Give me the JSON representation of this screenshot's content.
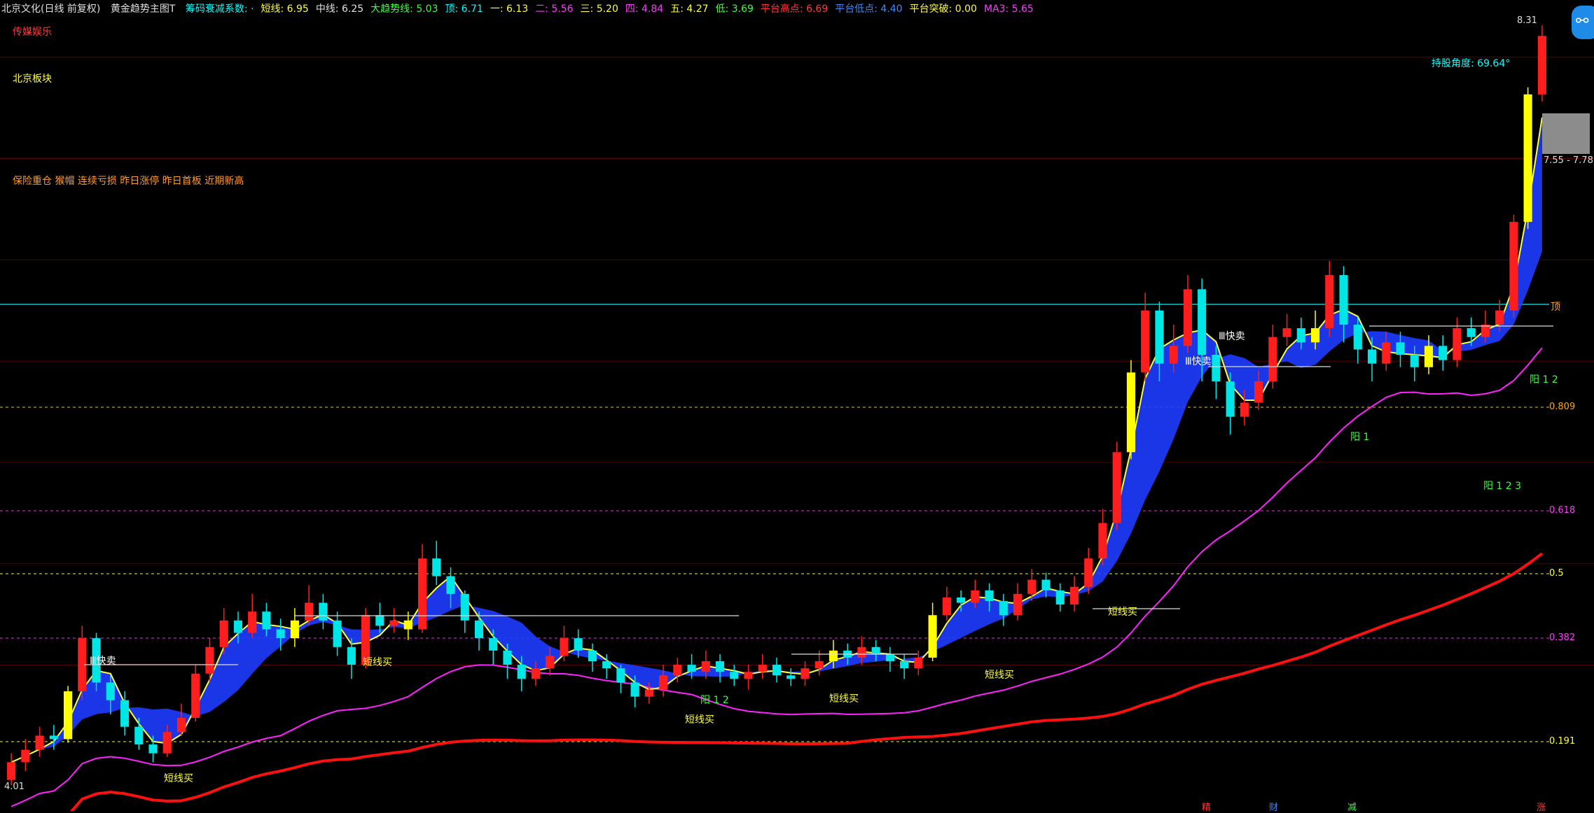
{
  "header": {
    "symbol": "北京文化(日线 前复权)",
    "indicator_name": "黄金趋势主图T",
    "indicators": [
      {
        "label": "筹码衰减系数: ·",
        "color": "#00ffff"
      },
      {
        "label": "短线: 6.95",
        "color": "#ffff3a"
      },
      {
        "label": "中线: 6.25",
        "color": "#e0e0e0"
      },
      {
        "label": "大趋势线: 5.03",
        "color": "#3aff3a"
      },
      {
        "label": "顶: 6.71",
        "color": "#00ffff"
      },
      {
        "label": "一: 6.13",
        "color": "#ffff3a"
      },
      {
        "label": "二: 5.56",
        "color": "#ff3aff"
      },
      {
        "label": "三: 5.20",
        "color": "#ffff3a"
      },
      {
        "label": "四: 4.84",
        "color": "#ff3aff"
      },
      {
        "label": "五: 4.27",
        "color": "#ffff3a"
      },
      {
        "label": "低: 3.69",
        "color": "#3aff3a"
      },
      {
        "label": "平台高点: 6.69",
        "color": "#ff3a3a"
      },
      {
        "label": "平台低点: 4.40",
        "color": "#3a8cff"
      },
      {
        "label": "平台突破: 0.00",
        "color": "#ffff3a"
      },
      {
        "label": "MA3: 5.65",
        "color": "#ff3aff"
      }
    ]
  },
  "side_labels": {
    "concept1": "传媒娱乐",
    "concept2": "北京板块",
    "concept3": "保险重仓 猴帽 连续亏损 昨日涨停 昨日首板 近期新高"
  },
  "angle_label": "持股角度: 69.64°",
  "price_high": "8.31",
  "price_low": "4.01",
  "range_label": "7.55 - 7.78",
  "fib_levels": [
    {
      "label": "0.809",
      "color": "#ffaa00"
    },
    {
      "label": "0.618",
      "color": "#ff3aff"
    },
    {
      "label": "0.5",
      "color": "#ffff3a"
    },
    {
      "label": "0.382",
      "color": "#ff3aff"
    },
    {
      "label": "0.191",
      "color": "#ffff3a"
    }
  ],
  "signals": [
    {
      "text": "Ⅲ快卖",
      "color": "#ffffff"
    },
    {
      "text": "Ⅲ快卖",
      "color": "#ffffff"
    },
    {
      "text": "Ⅲ快卖",
      "color": "#ffffff"
    },
    {
      "text": "短线买",
      "color": "#ffff3a"
    },
    {
      "text": "短线买",
      "color": "#ffff3a"
    },
    {
      "text": "短线买",
      "color": "#ffff3a"
    },
    {
      "text": "短线买",
      "color": "#ffff3a"
    },
    {
      "text": "短线买",
      "color": "#ffff3a"
    },
    {
      "text": "短线买",
      "color": "#ffff3a"
    },
    {
      "text": "顶",
      "color": "#ffaa00"
    },
    {
      "text": "阳 1 2",
      "color": "#3aff3a"
    },
    {
      "text": "阳 1 2 3",
      "color": "#3aff3a"
    },
    {
      "text": "阳 1 2",
      "color": "#3aff3a"
    },
    {
      "text": "阳 1",
      "color": "#3aff3a"
    }
  ],
  "bottom_tags": [
    {
      "text": "精",
      "color": "#ff3a3a"
    },
    {
      "text": "财",
      "color": "#3a8cff"
    },
    {
      "text": "减",
      "color": "#3aff3a"
    },
    {
      "text": "涨",
      "color": "#ff3a3a"
    }
  ],
  "colors": {
    "up_candle": "#ff1e1e",
    "down_candle": "#00e5e5",
    "limit_up_candle": "#ffff00",
    "band_fill": "#1e3cff",
    "short_line": "#ffff3a",
    "ma_magenta": "#ff22ff",
    "ma_red": "#ff1010",
    "hline_cyan": "#00cccc"
  },
  "chart_data": {
    "type": "candlestick",
    "title": "北京文化(日线 前复权)",
    "ylim": [
      4.01,
      8.31
    ],
    "candles": [
      {
        "o": 4.05,
        "c": 4.15,
        "h": 4.2,
        "l": 4.02
      },
      {
        "o": 4.15,
        "c": 4.22,
        "h": 4.28,
        "l": 4.1
      },
      {
        "o": 4.22,
        "c": 4.3,
        "h": 4.35,
        "l": 4.18
      },
      {
        "o": 4.3,
        "c": 4.28,
        "h": 4.36,
        "l": 4.22
      },
      {
        "o": 4.28,
        "c": 4.55,
        "h": 4.58,
        "l": 4.26
      },
      {
        "o": 4.55,
        "c": 4.85,
        "h": 4.92,
        "l": 4.5
      },
      {
        "o": 4.85,
        "c": 4.6,
        "h": 4.88,
        "l": 4.55
      },
      {
        "o": 4.6,
        "c": 4.5,
        "h": 4.64,
        "l": 4.42
      },
      {
        "o": 4.5,
        "c": 4.35,
        "h": 4.55,
        "l": 4.3
      },
      {
        "o": 4.35,
        "c": 4.25,
        "h": 4.4,
        "l": 4.22
      },
      {
        "o": 4.25,
        "c": 4.2,
        "h": 4.3,
        "l": 4.15
      },
      {
        "o": 4.2,
        "c": 4.32,
        "h": 4.36,
        "l": 4.18
      },
      {
        "o": 4.32,
        "c": 4.4,
        "h": 4.48,
        "l": 4.3
      },
      {
        "o": 4.4,
        "c": 4.65,
        "h": 4.7,
        "l": 4.38
      },
      {
        "o": 4.65,
        "c": 4.8,
        "h": 4.85,
        "l": 4.6
      },
      {
        "o": 4.8,
        "c": 4.95,
        "h": 5.02,
        "l": 4.76
      },
      {
        "o": 4.95,
        "c": 4.88,
        "h": 5.0,
        "l": 4.82
      },
      {
        "o": 4.88,
        "c": 5.0,
        "h": 5.1,
        "l": 4.85
      },
      {
        "o": 5.0,
        "c": 4.9,
        "h": 5.05,
        "l": 4.86
      },
      {
        "o": 4.9,
        "c": 4.85,
        "h": 4.96,
        "l": 4.78
      },
      {
        "o": 4.85,
        "c": 4.95,
        "h": 5.02,
        "l": 4.8
      },
      {
        "o": 4.95,
        "c": 5.05,
        "h": 5.15,
        "l": 4.92
      },
      {
        "o": 5.05,
        "c": 4.95,
        "h": 5.1,
        "l": 4.9
      },
      {
        "o": 4.95,
        "c": 4.8,
        "h": 5.0,
        "l": 4.75
      },
      {
        "o": 4.8,
        "c": 4.7,
        "h": 4.85,
        "l": 4.62
      },
      {
        "o": 4.7,
        "c": 4.98,
        "h": 5.02,
        "l": 4.68
      },
      {
        "o": 4.98,
        "c": 4.92,
        "h": 5.05,
        "l": 4.88
      },
      {
        "o": 4.92,
        "c": 4.95,
        "h": 5.02,
        "l": 4.88
      },
      {
        "o": 4.95,
        "c": 4.9,
        "h": 5.0,
        "l": 4.84
      },
      {
        "o": 4.9,
        "c": 5.3,
        "h": 5.38,
        "l": 4.88
      },
      {
        "o": 5.3,
        "c": 5.2,
        "h": 5.4,
        "l": 5.15
      },
      {
        "o": 5.2,
        "c": 5.1,
        "h": 5.25,
        "l": 5.02
      },
      {
        "o": 5.1,
        "c": 4.95,
        "h": 5.12,
        "l": 4.88
      },
      {
        "o": 4.95,
        "c": 4.85,
        "h": 5.0,
        "l": 4.78
      },
      {
        "o": 4.85,
        "c": 4.78,
        "h": 4.9,
        "l": 4.7
      },
      {
        "o": 4.78,
        "c": 4.7,
        "h": 4.82,
        "l": 4.62
      },
      {
        "o": 4.7,
        "c": 4.62,
        "h": 4.75,
        "l": 4.55
      },
      {
        "o": 4.62,
        "c": 4.68,
        "h": 4.72,
        "l": 4.58
      },
      {
        "o": 4.68,
        "c": 4.75,
        "h": 4.8,
        "l": 4.64
      },
      {
        "o": 4.75,
        "c": 4.85,
        "h": 4.92,
        "l": 4.72
      },
      {
        "o": 4.85,
        "c": 4.78,
        "h": 4.9,
        "l": 4.74
      },
      {
        "o": 4.78,
        "c": 4.72,
        "h": 4.82,
        "l": 4.66
      },
      {
        "o": 4.72,
        "c": 4.68,
        "h": 4.76,
        "l": 4.62
      },
      {
        "o": 4.68,
        "c": 4.6,
        "h": 4.7,
        "l": 4.54
      },
      {
        "o": 4.6,
        "c": 4.52,
        "h": 4.64,
        "l": 4.46
      },
      {
        "o": 4.52,
        "c": 4.56,
        "h": 4.6,
        "l": 4.48
      },
      {
        "o": 4.56,
        "c": 4.64,
        "h": 4.7,
        "l": 4.52
      },
      {
        "o": 4.64,
        "c": 4.7,
        "h": 4.74,
        "l": 4.6
      },
      {
        "o": 4.7,
        "c": 4.66,
        "h": 4.76,
        "l": 4.62
      },
      {
        "o": 4.66,
        "c": 4.72,
        "h": 4.78,
        "l": 4.62
      },
      {
        "o": 4.72,
        "c": 4.66,
        "h": 4.76,
        "l": 4.6
      },
      {
        "o": 4.66,
        "c": 4.62,
        "h": 4.7,
        "l": 4.58
      },
      {
        "o": 4.62,
        "c": 4.66,
        "h": 4.7,
        "l": 4.56
      },
      {
        "o": 4.66,
        "c": 4.7,
        "h": 4.76,
        "l": 4.62
      },
      {
        "o": 4.7,
        "c": 4.64,
        "h": 4.74,
        "l": 4.6
      },
      {
        "o": 4.64,
        "c": 4.62,
        "h": 4.68,
        "l": 4.58
      },
      {
        "o": 4.62,
        "c": 4.68,
        "h": 4.72,
        "l": 4.58
      },
      {
        "o": 4.68,
        "c": 4.72,
        "h": 4.78,
        "l": 4.64
      },
      {
        "o": 4.72,
        "c": 4.78,
        "h": 4.84,
        "l": 4.68
      },
      {
        "o": 4.78,
        "c": 4.74,
        "h": 4.82,
        "l": 4.7
      },
      {
        "o": 4.74,
        "c": 4.8,
        "h": 4.86,
        "l": 4.7
      },
      {
        "o": 4.8,
        "c": 4.76,
        "h": 4.84,
        "l": 4.72
      },
      {
        "o": 4.76,
        "c": 4.72,
        "h": 4.8,
        "l": 4.66
      },
      {
        "o": 4.72,
        "c": 4.68,
        "h": 4.76,
        "l": 4.62
      },
      {
        "o": 4.68,
        "c": 4.74,
        "h": 4.78,
        "l": 4.64
      },
      {
        "o": 4.74,
        "c": 4.98,
        "h": 5.05,
        "l": 4.72
      },
      {
        "o": 4.98,
        "c": 5.08,
        "h": 5.14,
        "l": 4.95
      },
      {
        "o": 5.08,
        "c": 5.05,
        "h": 5.12,
        "l": 5.0
      },
      {
        "o": 5.05,
        "c": 5.12,
        "h": 5.18,
        "l": 5.02
      },
      {
        "o": 5.12,
        "c": 5.06,
        "h": 5.16,
        "l": 5.0
      },
      {
        "o": 5.06,
        "c": 4.98,
        "h": 5.1,
        "l": 4.92
      },
      {
        "o": 4.98,
        "c": 5.1,
        "h": 5.16,
        "l": 4.95
      },
      {
        "o": 5.1,
        "c": 5.18,
        "h": 5.24,
        "l": 5.06
      },
      {
        "o": 5.18,
        "c": 5.12,
        "h": 5.22,
        "l": 5.08
      },
      {
        "o": 5.12,
        "c": 5.04,
        "h": 5.16,
        "l": 5.0
      },
      {
        "o": 5.04,
        "c": 5.14,
        "h": 5.2,
        "l": 5.0
      },
      {
        "o": 5.14,
        "c": 5.3,
        "h": 5.36,
        "l": 5.1
      },
      {
        "o": 5.3,
        "c": 5.5,
        "h": 5.58,
        "l": 5.26
      },
      {
        "o": 5.5,
        "c": 5.9,
        "h": 5.96,
        "l": 5.46
      },
      {
        "o": 5.9,
        "c": 6.35,
        "h": 6.42,
        "l": 5.86
      },
      {
        "o": 6.35,
        "c": 6.7,
        "h": 6.8,
        "l": 6.3
      },
      {
        "o": 6.7,
        "c": 6.4,
        "h": 6.75,
        "l": 6.3
      },
      {
        "o": 6.4,
        "c": 6.5,
        "h": 6.62,
        "l": 6.35
      },
      {
        "o": 6.5,
        "c": 6.82,
        "h": 6.9,
        "l": 6.46
      },
      {
        "o": 6.82,
        "c": 6.45,
        "h": 6.88,
        "l": 6.3
      },
      {
        "o": 6.45,
        "c": 6.3,
        "h": 6.5,
        "l": 6.2
      },
      {
        "o": 6.3,
        "c": 6.1,
        "h": 6.35,
        "l": 6.0
      },
      {
        "o": 6.1,
        "c": 6.18,
        "h": 6.25,
        "l": 6.05
      },
      {
        "o": 6.18,
        "c": 6.3,
        "h": 6.36,
        "l": 6.14
      },
      {
        "o": 6.3,
        "c": 6.55,
        "h": 6.62,
        "l": 6.26
      },
      {
        "o": 6.55,
        "c": 6.6,
        "h": 6.68,
        "l": 6.5
      },
      {
        "o": 6.6,
        "c": 6.52,
        "h": 6.66,
        "l": 6.48
      },
      {
        "o": 6.52,
        "c": 6.6,
        "h": 6.7,
        "l": 6.48
      },
      {
        "o": 6.6,
        "c": 6.9,
        "h": 6.98,
        "l": 6.55
      },
      {
        "o": 6.9,
        "c": 6.62,
        "h": 6.95,
        "l": 6.52
      },
      {
        "o": 6.62,
        "c": 6.48,
        "h": 6.66,
        "l": 6.4
      },
      {
        "o": 6.48,
        "c": 6.4,
        "h": 6.55,
        "l": 6.3
      },
      {
        "o": 6.4,
        "c": 6.52,
        "h": 6.58,
        "l": 6.36
      },
      {
        "o": 6.52,
        "c": 6.45,
        "h": 6.58,
        "l": 6.38
      },
      {
        "o": 6.45,
        "c": 6.38,
        "h": 6.5,
        "l": 6.3
      },
      {
        "o": 6.38,
        "c": 6.5,
        "h": 6.56,
        "l": 6.34
      },
      {
        "o": 6.5,
        "c": 6.42,
        "h": 6.56,
        "l": 6.36
      },
      {
        "o": 6.42,
        "c": 6.6,
        "h": 6.66,
        "l": 6.38
      },
      {
        "o": 6.6,
        "c": 6.55,
        "h": 6.66,
        "l": 6.5
      },
      {
        "o": 6.55,
        "c": 6.62,
        "h": 6.7,
        "l": 6.52
      },
      {
        "o": 6.62,
        "c": 6.7,
        "h": 6.76,
        "l": 6.58
      },
      {
        "o": 6.7,
        "c": 7.2,
        "h": 7.24,
        "l": 6.66
      },
      {
        "o": 7.2,
        "c": 7.92,
        "h": 7.96,
        "l": 7.16
      },
      {
        "o": 7.92,
        "c": 8.25,
        "h": 8.31,
        "l": 7.88
      }
    ],
    "limit_up_indices": [
      4,
      20,
      28,
      58,
      65,
      79,
      92,
      100,
      107
    ],
    "fib_values": [
      0.809,
      0.618,
      0.5,
      0.382,
      0.191
    ]
  }
}
